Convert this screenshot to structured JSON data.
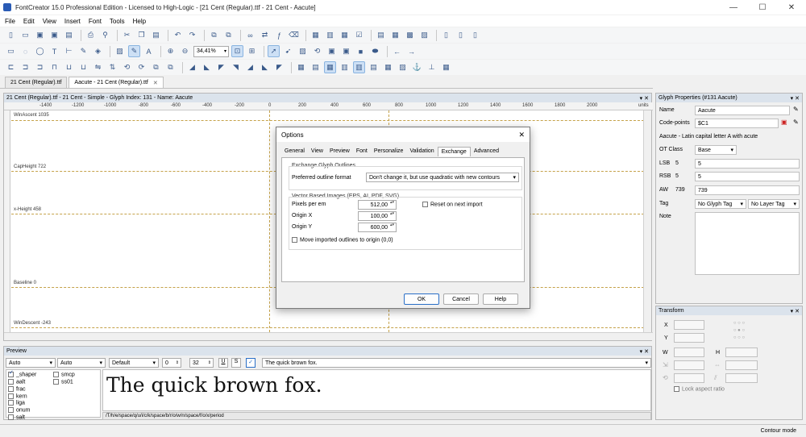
{
  "app": {
    "title": "FontCreator 15.0 Professional Edition - Licensed to High-Logic - [21 Cent (Regular).ttf - 21 Cent - Aacute]"
  },
  "menu": [
    "File",
    "Edit",
    "View",
    "Insert",
    "Font",
    "Tools",
    "Help"
  ],
  "toolbar": {
    "zoom": "34,41%"
  },
  "doc_tabs": [
    {
      "label": "21 Cent (Regular).ttf"
    },
    {
      "label": "Aacute - 21 Cent (Regular).ttf"
    }
  ],
  "glyph_panel": {
    "title": "21 Cent (Regular).ttf - 21 Cent - Simple - Glyph Index: 131 - Name: Aacute",
    "ruler": [
      "-1400",
      "-1200",
      "-1000",
      "-800",
      "-600",
      "-400",
      "-200",
      "0",
      "200",
      "400",
      "600",
      "800",
      "1000",
      "1200",
      "1400",
      "1600",
      "1800",
      "2000",
      "units"
    ],
    "metrics": [
      {
        "label": "WinAscent 1035"
      },
      {
        "label": "CapHeight 722"
      },
      {
        "label": "x-Height 458"
      },
      {
        "label": "Baseline 0"
      },
      {
        "label": "WinDescent -243"
      }
    ]
  },
  "properties": {
    "title": "Glyph Properties (#131 Aacute)",
    "name_label": "Name",
    "name_value": "Aacute",
    "codepoints_label": "Code-points",
    "codepoints_value": "$C1",
    "description": "Aacute - Latin capital letter A with acute",
    "otclass_label": "OT Class",
    "otclass_value": "Base",
    "lsb_label": "LSB",
    "lsb_num": "5",
    "lsb_value": "5",
    "rsb_label": "RSB",
    "rsb_num": "5",
    "rsb_value": "5",
    "aw_label": "AW",
    "aw_num": "739",
    "aw_value": "739",
    "tag_label": "Tag",
    "glyph_tag": "No Glyph Tag",
    "layer_tag": "No Layer Tag",
    "note_label": "Note"
  },
  "transform": {
    "title": "Transform",
    "x_label": "X",
    "y_label": "Y",
    "w_label": "W",
    "h_label": "H",
    "lock_label": "Lock aspect ratio"
  },
  "preview": {
    "title": "Preview",
    "sel1": "Auto",
    "sel2": "Auto",
    "sel3": "Default",
    "size1": "0",
    "size2": "32",
    "text_input": "The quick brown fox.",
    "features_col1": [
      {
        "name": "_shaper",
        "checked": true
      },
      {
        "name": "aalt",
        "checked": false
      },
      {
        "name": "frac",
        "checked": false
      },
      {
        "name": "kern",
        "checked": false
      },
      {
        "name": "liga",
        "checked": false
      },
      {
        "name": "onum",
        "checked": false
      },
      {
        "name": "salt",
        "checked": false
      }
    ],
    "features_col2": [
      {
        "name": "smcp",
        "checked": false
      },
      {
        "name": "ss01",
        "checked": false
      }
    ],
    "sample": "The quick brown fox.",
    "glyph_path": "/T/h/e/space/q/u/i/c/k/space/b/r/o/w/n/space/f/o/x/period"
  },
  "status": {
    "mode": "Contour mode"
  },
  "dialog": {
    "title": "Options",
    "tabs": [
      "General",
      "View",
      "Preview",
      "Font",
      "Personalize",
      "Validation",
      "Exchange",
      "Advanced"
    ],
    "active_tab": "Exchange",
    "group1_label": "Exchange Glyph Outlines",
    "outline_format_label": "Preferred outline format",
    "outline_format_value": "Don't change it, but use quadratic with new contours",
    "group2_label": "Vector Based Images (EPS, AI, PDF, SVG)",
    "pixels_label": "Pixels per em",
    "pixels_value": "512,00",
    "originx_label": "Origin X",
    "originx_value": "100,00",
    "originy_label": "Origin Y",
    "originy_value": "600,00",
    "reset_label": "Reset on next import",
    "move_label": "Move imported outlines to origin (0,0)",
    "ok": "OK",
    "cancel": "Cancel",
    "help": "Help"
  },
  "colors": {
    "accent": "#2a6fc7",
    "metric_line": "#c5a24a",
    "panel_header": "#dbe3ec"
  }
}
